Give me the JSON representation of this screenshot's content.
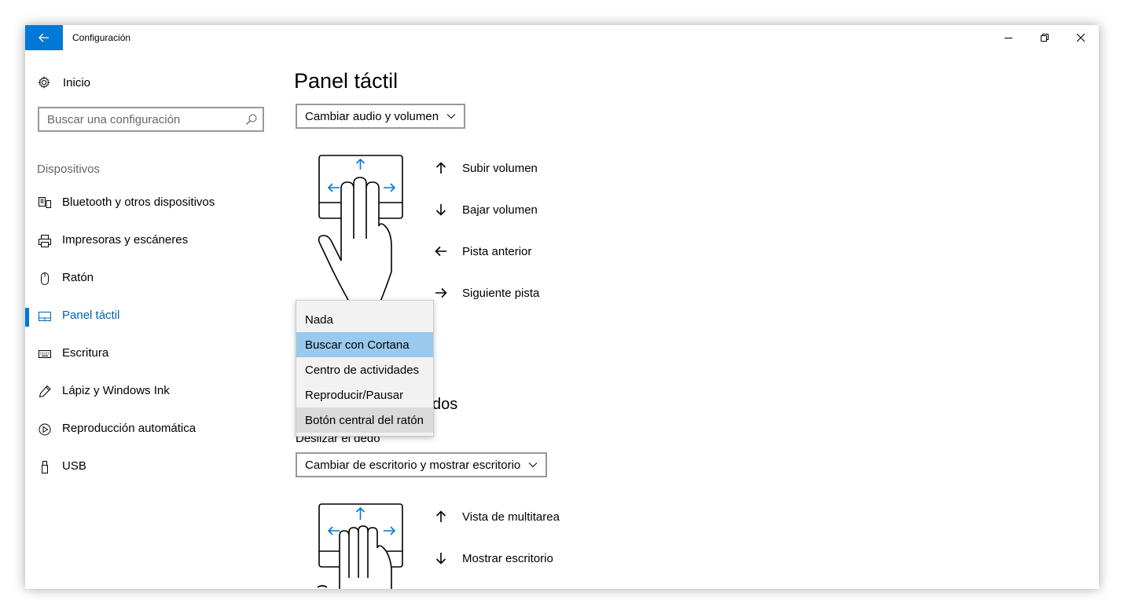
{
  "window": {
    "title": "Configuración"
  },
  "sidebar": {
    "home_label": "Inicio",
    "search_placeholder": "Buscar una configuración",
    "section_title": "Dispositivos",
    "items": [
      {
        "label": "Bluetooth y otros dispositivos",
        "icon": "bluetooth-devices-icon"
      },
      {
        "label": "Impresoras y escáneres",
        "icon": "printer-icon"
      },
      {
        "label": "Ratón",
        "icon": "mouse-icon"
      },
      {
        "label": "Panel táctil",
        "icon": "touchpad-icon",
        "active": true
      },
      {
        "label": "Escritura",
        "icon": "keyboard-icon"
      },
      {
        "label": "Lápiz y Windows Ink",
        "icon": "pen-icon"
      },
      {
        "label": "Reproducción automática",
        "icon": "autoplay-icon"
      },
      {
        "label": "USB",
        "icon": "usb-icon"
      }
    ]
  },
  "main": {
    "title": "Panel táctil",
    "three_finger": {
      "combo_value": "Cambiar audio y volumen",
      "gestures": [
        {
          "direction": "up",
          "label": "Subir volumen"
        },
        {
          "direction": "down",
          "label": "Bajar volumen"
        },
        {
          "direction": "left",
          "label": "Pista anterior"
        },
        {
          "direction": "right",
          "label": "Siguiente pista"
        }
      ]
    },
    "dropdown": {
      "options": [
        "Nada",
        "Buscar con Cortana",
        "Centro de actividades",
        "Reproducir/Pausar",
        "Botón central del ratón"
      ],
      "selected_index": 1,
      "hovered_index": 4
    },
    "four_finger": {
      "section_title_partial": "dos",
      "swipe_label_partial": "Deslizar el dedo",
      "combo_value": "Cambiar de escritorio y mostrar escritorio",
      "gestures": [
        {
          "direction": "up",
          "label": "Vista de multitarea"
        },
        {
          "direction": "down",
          "label": "Mostrar escritorio"
        }
      ]
    }
  },
  "colors": {
    "accent": "#0078d7",
    "selection": "#99c9ef",
    "hover": "#dadada"
  }
}
